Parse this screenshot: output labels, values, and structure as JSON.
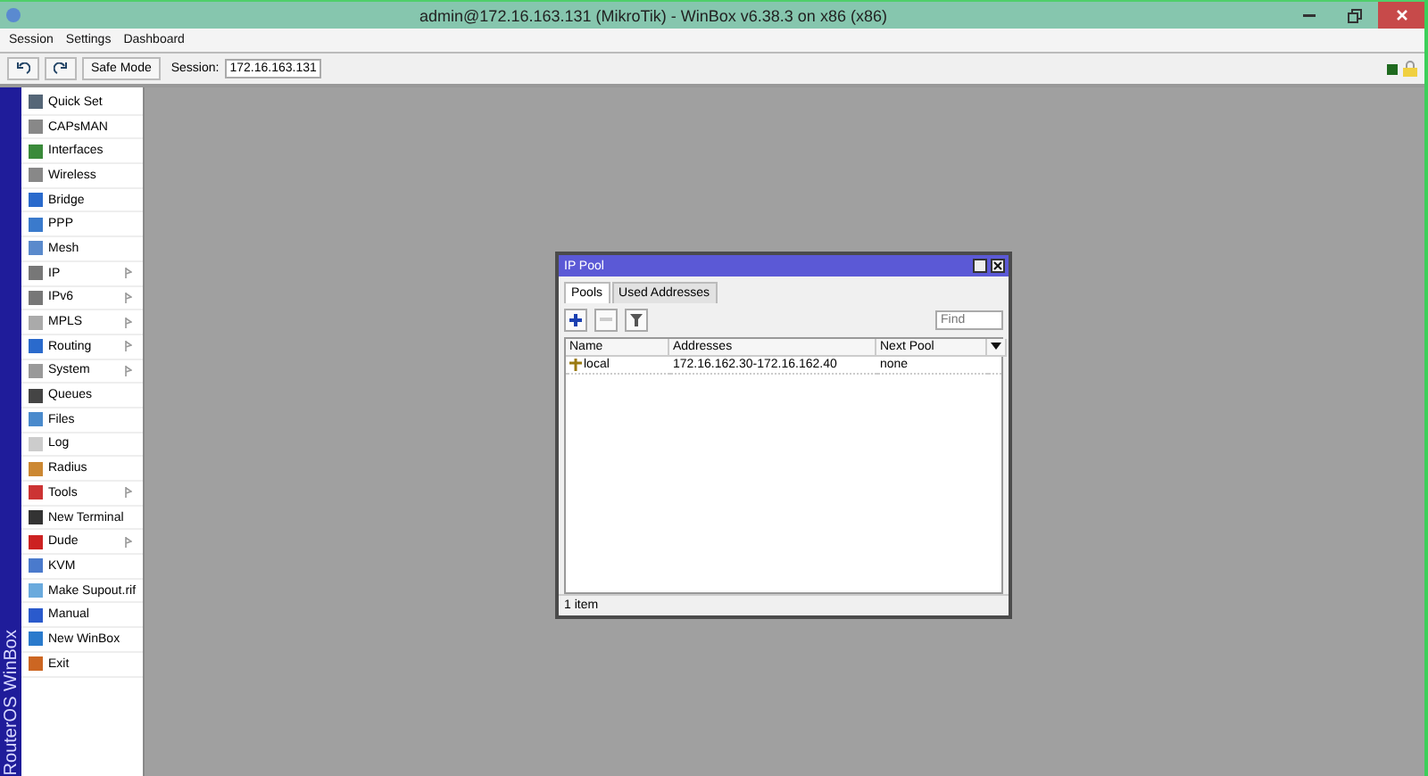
{
  "window": {
    "title": "admin@172.16.163.131 (MikroTik) - WinBox v6.38.3 on x86 (x86)"
  },
  "menu": [
    "Session",
    "Settings",
    "Dashboard"
  ],
  "toolbar": {
    "safe_mode": "Safe Mode",
    "session_label": "Session:",
    "session_value": "172.16.163.131"
  },
  "sidebar": {
    "brand": "RouterOS WinBox",
    "items": [
      {
        "label": "Quick Set",
        "has_submenu": false,
        "color": "#556677"
      },
      {
        "label": "CAPsMAN",
        "has_submenu": false,
        "color": "#888888"
      },
      {
        "label": "Interfaces",
        "has_submenu": false,
        "color": "#3a8a3a"
      },
      {
        "label": "Wireless",
        "has_submenu": false,
        "color": "#888888"
      },
      {
        "label": "Bridge",
        "has_submenu": false,
        "color": "#2a6acc"
      },
      {
        "label": "PPP",
        "has_submenu": false,
        "color": "#3a7acc"
      },
      {
        "label": "Mesh",
        "has_submenu": false,
        "color": "#5a8acc"
      },
      {
        "label": "IP",
        "has_submenu": true,
        "color": "#777777"
      },
      {
        "label": "IPv6",
        "has_submenu": true,
        "color": "#777777"
      },
      {
        "label": "MPLS",
        "has_submenu": true,
        "color": "#aaaaaa"
      },
      {
        "label": "Routing",
        "has_submenu": true,
        "color": "#2a6acc"
      },
      {
        "label": "System",
        "has_submenu": true,
        "color": "#999999"
      },
      {
        "label": "Queues",
        "has_submenu": false,
        "color": "#444444"
      },
      {
        "label": "Files",
        "has_submenu": false,
        "color": "#4a8acc"
      },
      {
        "label": "Log",
        "has_submenu": false,
        "color": "#cccccc"
      },
      {
        "label": "Radius",
        "has_submenu": false,
        "color": "#cc8833"
      },
      {
        "label": "Tools",
        "has_submenu": true,
        "color": "#cc3333"
      },
      {
        "label": "New Terminal",
        "has_submenu": false,
        "color": "#333333"
      },
      {
        "label": "Dude",
        "has_submenu": true,
        "color": "#cc2222"
      },
      {
        "label": "KVM",
        "has_submenu": false,
        "color": "#4a7acc"
      },
      {
        "label": "Make Supout.rif",
        "has_submenu": false,
        "color": "#6aaadd"
      },
      {
        "label": "Manual",
        "has_submenu": false,
        "color": "#2a5acc"
      },
      {
        "label": "New WinBox",
        "has_submenu": false,
        "color": "#2a7acc"
      },
      {
        "label": "Exit",
        "has_submenu": false,
        "color": "#cc6622"
      }
    ]
  },
  "ip_pool": {
    "title": "IP Pool",
    "tabs": [
      {
        "label": "Pools",
        "selected": true
      },
      {
        "label": "Used Addresses",
        "selected": false
      }
    ],
    "find": {
      "placeholder": "Find"
    },
    "columns": [
      "Name",
      "Addresses",
      "Next Pool"
    ],
    "rows": [
      {
        "name": "local",
        "addresses": "172.16.162.30-172.16.162.40",
        "next_pool": "none"
      }
    ],
    "status": "1 item"
  }
}
